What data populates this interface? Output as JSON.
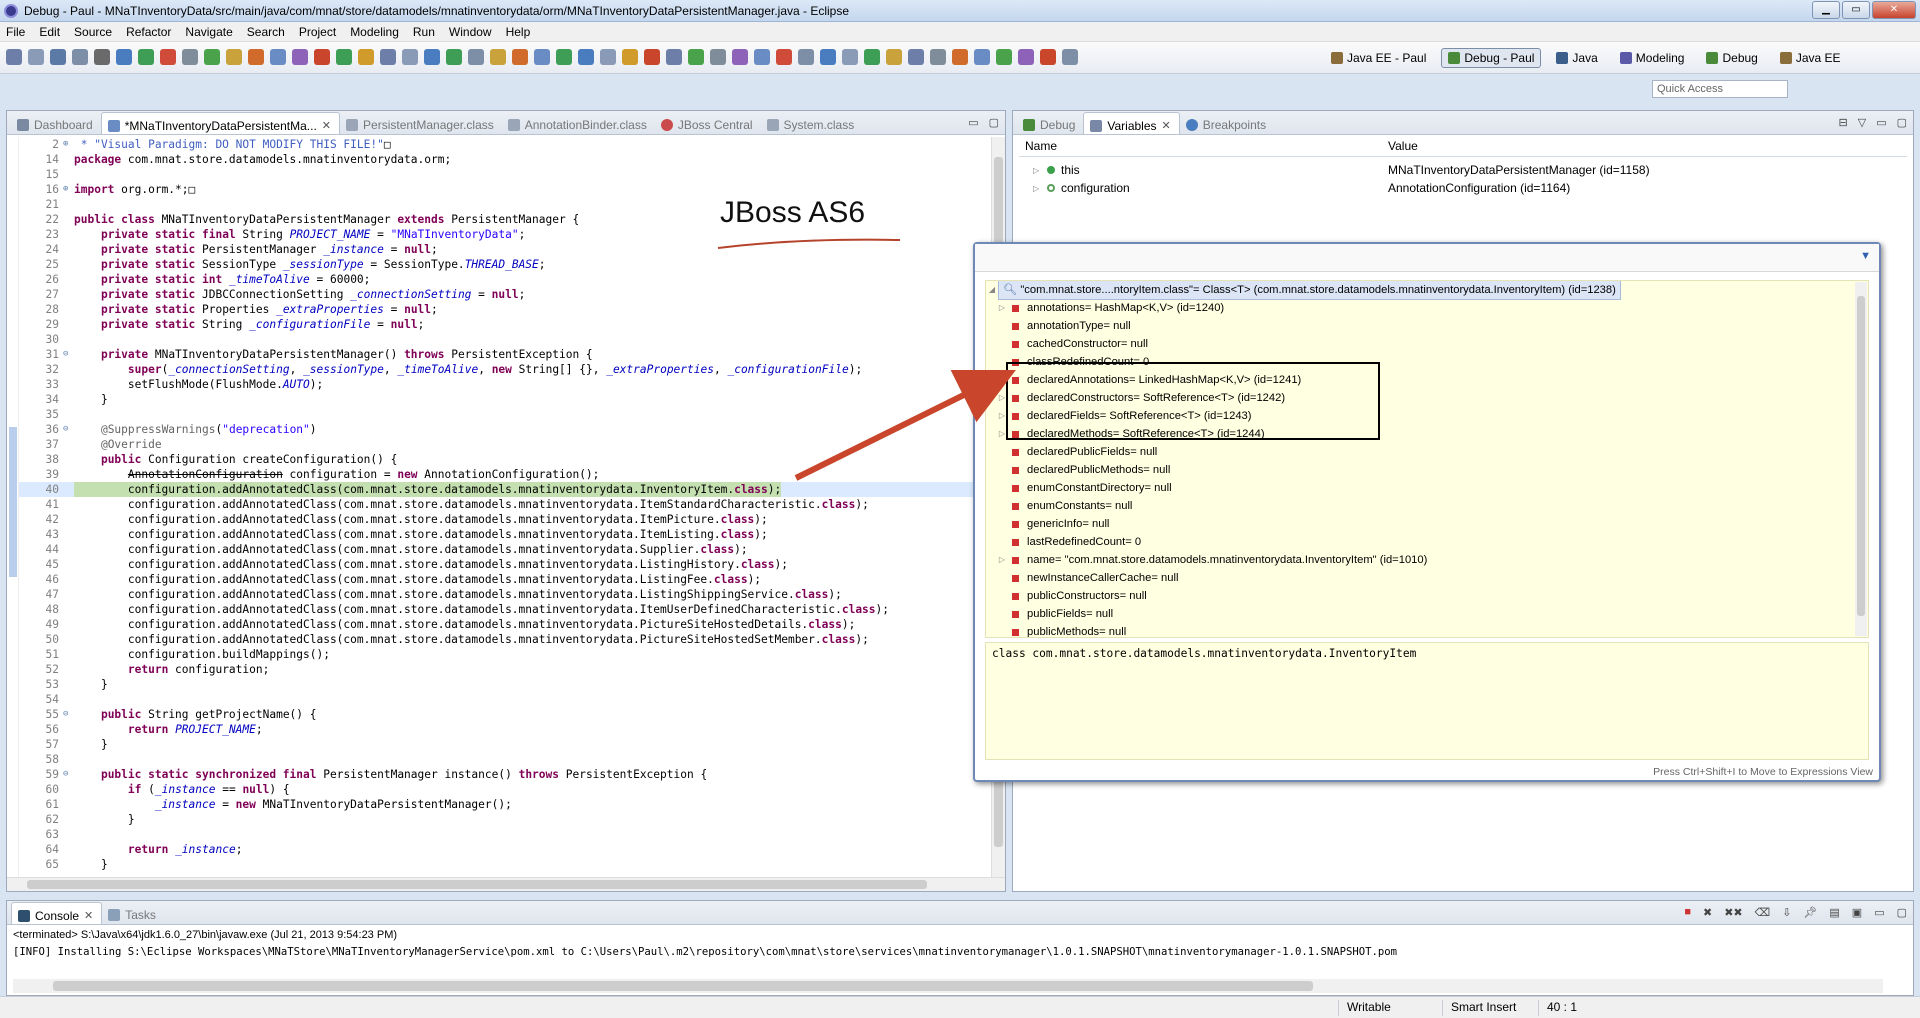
{
  "window": {
    "title": "Debug - Paul - MNaTInventoryData/src/main/java/com/mnat/store/datamodels/mnatinventorydata/orm/MNaTInventoryDataPersistentManager.java - Eclipse"
  },
  "menu": [
    "File",
    "Edit",
    "Source",
    "Refactor",
    "Navigate",
    "Search",
    "Project",
    "Modeling",
    "Run",
    "Window",
    "Help"
  ],
  "perspectives": [
    {
      "label": "Java EE - Paul",
      "active": false
    },
    {
      "label": "Debug - Paul",
      "active": true
    },
    {
      "label": "Java",
      "active": false
    },
    {
      "label": "Modeling",
      "active": false
    },
    {
      "label": "Debug",
      "active": false
    },
    {
      "label": "Java EE",
      "active": false
    }
  ],
  "quick_access": {
    "placeholder": "Quick Access"
  },
  "editor_tabs": [
    {
      "label": "Dashboard",
      "active": false
    },
    {
      "label": "*MNaTInventoryDataPersistentMa...",
      "active": true
    },
    {
      "label": "PersistentManager.class",
      "active": false
    },
    {
      "label": "AnnotationBinder.class",
      "active": false
    },
    {
      "label": "JBoss Central",
      "active": false
    },
    {
      "label": "System.class",
      "active": false
    }
  ],
  "code_lines": [
    {
      "n": "2",
      "fold": "⊕",
      "html": "<span class=\"cm\"> * \"Visual Paradigm: DO NOT MODIFY THIS FILE!\"</span>□"
    },
    {
      "n": "14",
      "fold": "",
      "html": "<span class=\"k\">package</span> com.mnat.store.datamodels.mnatinventorydata.orm;"
    },
    {
      "n": "15",
      "fold": "",
      "html": ""
    },
    {
      "n": "16",
      "fold": "⊕",
      "html": "<span class=\"k\">import</span> org.orm.*;□"
    },
    {
      "n": "21",
      "fold": "",
      "html": ""
    },
    {
      "n": "22",
      "fold": "",
      "html": "<span class=\"k\">public class</span> MNaTInventoryDataPersistentManager <span class=\"k\">extends</span> PersistentManager {"
    },
    {
      "n": "23",
      "fold": "",
      "html": "    <span class=\"k\">private static final</span> String <span class=\"f\">PROJECT_NAME</span> = <span class=\"s\">\"MNaTInventoryData\"</span>;"
    },
    {
      "n": "24",
      "fold": "",
      "html": "    <span class=\"k\">private static</span> PersistentManager <span class=\"f\">_instance</span> = <span class=\"k\">null</span>;"
    },
    {
      "n": "25",
      "fold": "",
      "html": "    <span class=\"k\">private static</span> SessionType <span class=\"f\">_sessionType</span> = SessionType.<span class=\"f\">THREAD_BASE</span>;"
    },
    {
      "n": "26",
      "fold": "",
      "html": "    <span class=\"k\">private static int</span> <span class=\"f\">_timeToAlive</span> = 60000;"
    },
    {
      "n": "27",
      "fold": "",
      "html": "    <span class=\"k\">private static</span> JDBCConnectionSetting <span class=\"f\">_connectionSetting</span> = <span class=\"k\">null</span>;"
    },
    {
      "n": "28",
      "fold": "",
      "html": "    <span class=\"k\">private static</span> Properties <span class=\"f\">_extraProperties</span> = <span class=\"k\">null</span>;"
    },
    {
      "n": "29",
      "fold": "",
      "html": "    <span class=\"k\">private static</span> String <span class=\"f\">_configurationFile</span> = <span class=\"k\">null</span>;"
    },
    {
      "n": "30",
      "fold": "",
      "html": ""
    },
    {
      "n": "31",
      "fold": "⊖",
      "html": "    <span class=\"k\">private</span> MNaTInventoryDataPersistentManager() <span class=\"k\">throws</span> PersistentException {"
    },
    {
      "n": "32",
      "fold": "",
      "html": "        <span class=\"k\">super</span>(<span class=\"f\">_connectionSetting</span>, <span class=\"f\">_sessionType</span>, <span class=\"f\">_timeToAlive</span>, <span class=\"k\">new</span> String[] {}, <span class=\"f\">_extraProperties</span>, <span class=\"f\">_configurationFile</span>);"
    },
    {
      "n": "33",
      "fold": "",
      "html": "        setFlushMode(FlushMode.<span class=\"f\">AUTO</span>);"
    },
    {
      "n": "34",
      "fold": "",
      "html": "    }"
    },
    {
      "n": "35",
      "fold": "",
      "html": ""
    },
    {
      "n": "36",
      "fold": "⊖",
      "html": "    <span class=\"an\">@SuppressWarnings</span>(<span class=\"s\">\"deprecation\"</span>)"
    },
    {
      "n": "37",
      "fold": "",
      "html": "    <span class=\"an\">@Override</span>"
    },
    {
      "n": "38",
      "fold": "",
      "html": "    <span class=\"k\">public</span> Configuration createConfiguration() {"
    },
    {
      "n": "39",
      "fold": "",
      "html": "        <span class=\"strike\">AnnotationConfiguration</span> configuration = <span class=\"k\">new</span> AnnotationConfiguration();"
    },
    {
      "n": "40",
      "fold": "",
      "hl": true,
      "html": "        configuration.addAnnotatedClass(com.mnat.store.datamodels.mnatinventorydata.InventoryItem.<span class=\"k\">class</span>);"
    },
    {
      "n": "41",
      "fold": "",
      "html": "        configuration.addAnnotatedClass(com.mnat.store.datamodels.mnatinventorydata.ItemStandardCharacteristic.<span class=\"k\">class</span>);"
    },
    {
      "n": "42",
      "fold": "",
      "html": "        configuration.addAnnotatedClass(com.mnat.store.datamodels.mnatinventorydata.ItemPicture.<span class=\"k\">class</span>);"
    },
    {
      "n": "43",
      "fold": "",
      "html": "        configuration.addAnnotatedClass(com.mnat.store.datamodels.mnatinventorydata.ItemListing.<span class=\"k\">class</span>);"
    },
    {
      "n": "44",
      "fold": "",
      "html": "        configuration.addAnnotatedClass(com.mnat.store.datamodels.mnatinventorydata.Supplier.<span class=\"k\">class</span>);"
    },
    {
      "n": "45",
      "fold": "",
      "html": "        configuration.addAnnotatedClass(com.mnat.store.datamodels.mnatinventorydata.ListingHistory.<span class=\"k\">class</span>);"
    },
    {
      "n": "46",
      "fold": "",
      "html": "        configuration.addAnnotatedClass(com.mnat.store.datamodels.mnatinventorydata.ListingFee.<span class=\"k\">class</span>);"
    },
    {
      "n": "47",
      "fold": "",
      "html": "        configuration.addAnnotatedClass(com.mnat.store.datamodels.mnatinventorydata.ListingShippingService.<span class=\"k\">class</span>);"
    },
    {
      "n": "48",
      "fold": "",
      "html": "        configuration.addAnnotatedClass(com.mnat.store.datamodels.mnatinventorydata.ItemUserDefinedCharacteristic.<span class=\"k\">class</span>);"
    },
    {
      "n": "49",
      "fold": "",
      "html": "        configuration.addAnnotatedClass(com.mnat.store.datamodels.mnatinventorydata.PictureSiteHostedDetails.<span class=\"k\">class</span>);"
    },
    {
      "n": "50",
      "fold": "",
      "html": "        configuration.addAnnotatedClass(com.mnat.store.datamodels.mnatinventorydata.PictureSiteHostedSetMember.<span class=\"k\">class</span>);"
    },
    {
      "n": "51",
      "fold": "",
      "html": "        configuration.buildMappings();"
    },
    {
      "n": "52",
      "fold": "",
      "html": "        <span class=\"k\">return</span> configuration;"
    },
    {
      "n": "53",
      "fold": "",
      "html": "    }"
    },
    {
      "n": "54",
      "fold": "",
      "html": ""
    },
    {
      "n": "55",
      "fold": "⊖",
      "html": "    <span class=\"k\">public</span> String getProjectName() {"
    },
    {
      "n": "56",
      "fold": "",
      "html": "        <span class=\"k\">return</span> <span class=\"f\">PROJECT_NAME</span>;"
    },
    {
      "n": "57",
      "fold": "",
      "html": "    }"
    },
    {
      "n": "58",
      "fold": "",
      "html": ""
    },
    {
      "n": "59",
      "fold": "⊖",
      "html": "    <span class=\"k\">public static synchronized final</span> PersistentManager instance() <span class=\"k\">throws</span> PersistentException {"
    },
    {
      "n": "60",
      "fold": "",
      "html": "        <span class=\"k\">if</span> (<span class=\"f\">_instance</span> == <span class=\"k\">null</span>) {"
    },
    {
      "n": "61",
      "fold": "",
      "html": "            <span class=\"f\">_instance</span> = <span class=\"k\">new</span> MNaTInventoryDataPersistentManager();"
    },
    {
      "n": "62",
      "fold": "",
      "html": "        }"
    },
    {
      "n": "63",
      "fold": "",
      "html": ""
    },
    {
      "n": "64",
      "fold": "",
      "html": "        <span class=\"k\">return</span> <span class=\"f\">_instance</span>;"
    },
    {
      "n": "65",
      "fold": "",
      "html": "    }"
    }
  ],
  "annotation": {
    "label": "JBoss AS6"
  },
  "right_tabs": [
    {
      "label": "Debug",
      "active": false
    },
    {
      "label": "Variables",
      "active": true
    },
    {
      "label": "Breakpoints",
      "active": false
    }
  ],
  "variables": {
    "col_name": "Name",
    "col_value": "Value",
    "rows": [
      {
        "name": "this",
        "value": "MNaTInventoryDataPersistentManager  (id=1158)"
      },
      {
        "name": "configuration",
        "value": "AnnotationConfiguration  (id=1164)"
      }
    ]
  },
  "inspect": {
    "root": "\"com.mnat.store....ntoryItem.class\"= Class<T>  (com.mnat.store.datamodels.mnatinventorydata.InventoryItem) (id=1238)",
    "rows": [
      {
        "label": "annotations= HashMap<K,V>  (id=1240)",
        "exp": true
      },
      {
        "label": "annotationType= null",
        "exp": false
      },
      {
        "label": "cachedConstructor= null",
        "exp": false
      },
      {
        "label": "classRedefinedCount= 0",
        "exp": false
      },
      {
        "label": "declaredAnnotations= LinkedHashMap<K,V>  (id=1241)",
        "exp": true
      },
      {
        "label": "declaredConstructors= SoftReference<T>  (id=1242)",
        "exp": true
      },
      {
        "label": "declaredFields= SoftReference<T>  (id=1243)",
        "exp": true
      },
      {
        "label": "declaredMethods= SoftReference<T>  (id=1244)",
        "exp": true
      },
      {
        "label": "declaredPublicFields= null",
        "exp": false
      },
      {
        "label": "declaredPublicMethods= null",
        "exp": false
      },
      {
        "label": "enumConstantDirectory= null",
        "exp": false
      },
      {
        "label": "enumConstants= null",
        "exp": false
      },
      {
        "label": "genericInfo= null",
        "exp": false
      },
      {
        "label": "lastRedefinedCount= 0",
        "exp": false
      },
      {
        "label": "name= \"com.mnat.store.datamodels.mnatinventorydata.InventoryItem\" (id=1010)",
        "exp": true
      },
      {
        "label": "newInstanceCallerCache= null",
        "exp": false
      },
      {
        "label": "publicConstructors= null",
        "exp": false
      },
      {
        "label": "publicFields= null",
        "exp": false
      },
      {
        "label": "publicMethods= null",
        "exp": false
      }
    ],
    "detail": "class com.mnat.store.datamodels.mnatinventorydata.InventoryItem",
    "hint": "Press Ctrl+Shift+I to Move to Expressions View"
  },
  "console": {
    "tabs": [
      {
        "label": "Console",
        "active": true
      },
      {
        "label": "Tasks",
        "active": false
      }
    ],
    "terminated": "<terminated> S:\\Java\\x64\\jdk1.6.0_27\\bin\\javaw.exe (Jul 21, 2013 9:54:23 PM)",
    "log": "[INFO] Installing S:\\Eclipse Workspaces\\MNaTStore\\MNaTInventoryManagerService\\pom.xml to C:\\Users\\Paul\\.m2\\repository\\com\\mnat\\store\\services\\mnatinventorymanager\\1.0.1.SNAPSHOT\\mnatinventorymanager-1.0.1.SNAPSHOT.pom"
  },
  "status": {
    "writable": "Writable",
    "insert": "Smart Insert",
    "position": "40 : 1"
  },
  "colors": {
    "highlight": "#c4e0b0",
    "arrow": "#c9462c",
    "tree_bg": "#ffffe1"
  }
}
